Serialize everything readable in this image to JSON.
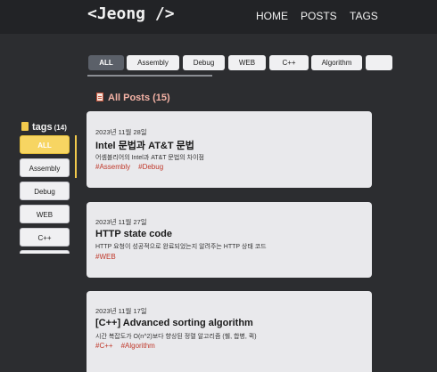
{
  "header": {
    "logo": "<Jeong />",
    "nav": [
      "HOME",
      "POSTS",
      "TAGS"
    ]
  },
  "filters": {
    "items": [
      "ALL",
      "Assembly",
      "Debug",
      "WEB",
      "C++",
      "Algorithm"
    ],
    "active": "ALL"
  },
  "posts_header": {
    "label": "All Posts",
    "count": "(15)"
  },
  "sidebar": {
    "title": "tags",
    "count": "(14)",
    "items": [
      "ALL",
      "Assembly",
      "Debug",
      "WEB",
      "C++"
    ]
  },
  "posts": [
    {
      "date": "2023년 11월 28일",
      "title": "Intel 문법과 AT&T 문법",
      "desc": "어셈블리어의 Intel과 AT&T 문법의 차이점",
      "tags": [
        "#Assembly",
        "#Debug"
      ]
    },
    {
      "date": "2023년 11월 27일",
      "title": "HTTP state code",
      "desc": "HTTP 요청이 성공적으로 완료되었는지 알려주는 HTTP 상태 코드",
      "tags": [
        "#WEB"
      ]
    },
    {
      "date": "2023년 11월 17일",
      "title": "[C++] Advanced sorting algorithm",
      "desc": "시간 복잡도가 O(n^2)보다 향상된 정렬 알고리즘 (쉘, 합병, 퀵)",
      "tags": [
        "#C++",
        "#Algorithm"
      ]
    }
  ],
  "colors": {
    "background": "#2c2d30",
    "header": "#222326",
    "accent_yellow": "#f7d562",
    "tag_red": "#c0392b",
    "posts_heading": "#f5b3a6"
  }
}
